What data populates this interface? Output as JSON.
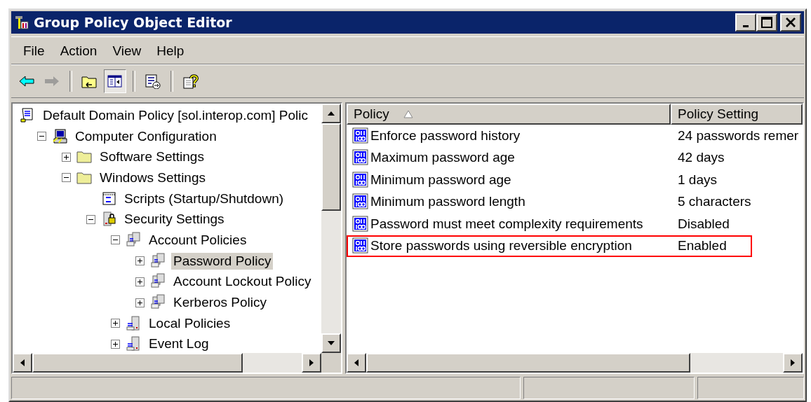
{
  "window": {
    "title": "Group Policy Object Editor"
  },
  "menu": [
    {
      "label": "File"
    },
    {
      "label": "Action"
    },
    {
      "label": "View"
    },
    {
      "label": "Help"
    }
  ],
  "toolbar": [
    {
      "kind": "back",
      "disabled": false
    },
    {
      "kind": "forward",
      "disabled": true
    },
    {
      "kind": "separator"
    },
    {
      "kind": "up",
      "disabled": false
    },
    {
      "kind": "tree",
      "disabled": false,
      "pressed": true
    },
    {
      "kind": "separator"
    },
    {
      "kind": "export",
      "disabled": false
    },
    {
      "kind": "separator"
    },
    {
      "kind": "help",
      "disabled": false
    }
  ],
  "tree": [
    {
      "label": "Default Domain Policy [sol.interop.com] Polic",
      "kind": "root",
      "selected": false,
      "children": [
        {
          "label": "Computer Configuration",
          "kind": "computer",
          "expanded": true,
          "selected": false,
          "children": [
            {
              "label": "Software Settings",
              "kind": "folder",
              "expanded": false,
              "selected": false
            },
            {
              "label": "Windows Settings",
              "kind": "folder",
              "expanded": true,
              "selected": false,
              "children": [
                {
                  "label": "Scripts (Startup/Shutdown)",
                  "kind": "scripts",
                  "selected": false
                },
                {
                  "label": "Security Settings",
                  "kind": "security",
                  "expanded": true,
                  "selected": false,
                  "children": [
                    {
                      "label": "Account Policies",
                      "kind": "policies",
                      "expanded": true,
                      "selected": false,
                      "children": [
                        {
                          "label": "Password Policy",
                          "kind": "policies",
                          "expanded": false,
                          "selected": true
                        },
                        {
                          "label": "Account Lockout Policy",
                          "kind": "policies",
                          "expanded": false,
                          "selected": false
                        },
                        {
                          "label": "Kerberos Policy",
                          "kind": "policies",
                          "expanded": false,
                          "selected": false
                        }
                      ]
                    },
                    {
                      "label": "Local Policies",
                      "kind": "server",
                      "expanded": false,
                      "selected": false
                    },
                    {
                      "label": "Event Log",
                      "kind": "server",
                      "expanded": false,
                      "selected": false
                    }
                  ]
                }
              ]
            }
          ]
        }
      ]
    }
  ],
  "table": {
    "columns": [
      {
        "label": "Policy",
        "sorted_ascending": true
      },
      {
        "label": "Policy Setting"
      }
    ],
    "rows": [
      {
        "policy": "Enforce password history",
        "setting": "24 passwords remer",
        "highlighted": false
      },
      {
        "policy": "Maximum password age",
        "setting": "42 days",
        "highlighted": false
      },
      {
        "policy": "Minimum password age",
        "setting": "1 days",
        "highlighted": false
      },
      {
        "policy": "Minimum password length",
        "setting": "5 characters",
        "highlighted": false
      },
      {
        "policy": "Password must meet complexity requirements",
        "setting": "Disabled",
        "highlighted": false
      },
      {
        "policy": "Store passwords using reversible encryption",
        "setting": "Enabled",
        "highlighted": true
      }
    ]
  }
}
